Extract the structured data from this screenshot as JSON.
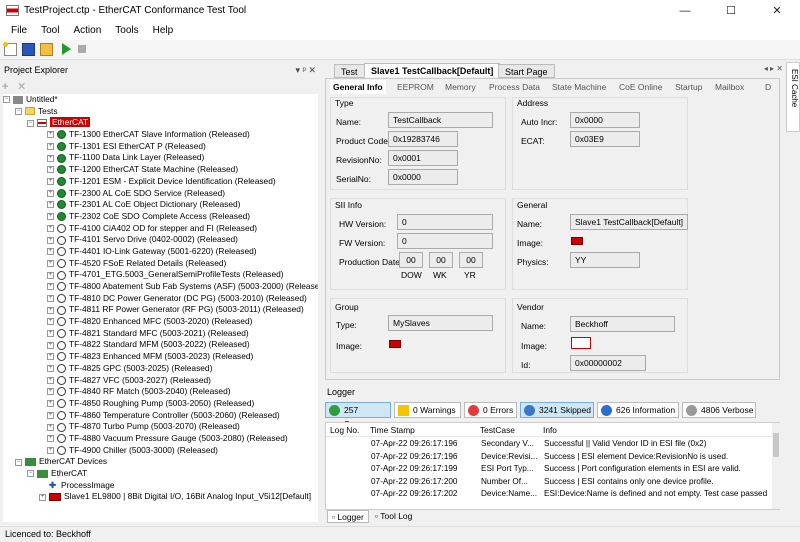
{
  "window": {
    "title": "TestProject.ctp - EtherCAT Conformance Test Tool",
    "minimize": "—",
    "maximize": "☐",
    "close": "✕"
  },
  "menu": [
    "File",
    "Tool",
    "Action",
    "Tools",
    "Help"
  ],
  "explorer": {
    "title": "Project Explorer",
    "pin": "▾ ᵖ ✕",
    "root": "Untitled*",
    "tests": "Tests",
    "ethercat": "EtherCAT",
    "items": [
      {
        "label": "TF-1300 EtherCAT Slave Information (Released)",
        "status": "pass"
      },
      {
        "label": "TF-1301 ESI EtherCAT P (Released)",
        "status": "pass"
      },
      {
        "label": "TF-1100 Data Link Layer (Released)",
        "status": "pass"
      },
      {
        "label": "TF-1200 EtherCAT State Machine (Released)",
        "status": "pass"
      },
      {
        "label": "TF-1201 ESM - Explicit Device Identification (Released)",
        "status": "pass"
      },
      {
        "label": "TF-2300 AL CoE SDO Service (Released)",
        "status": "pass"
      },
      {
        "label": "TF-2301 AL CoE Object Dictionary (Released)",
        "status": "pass"
      },
      {
        "label": "TF-2302 CoE SDO Complete Access (Released)",
        "status": "pass"
      },
      {
        "label": "TF-4100 CiA402 OD for stepper and FI (Released)",
        "status": "none"
      },
      {
        "label": "TF-4101 Servo Drive (0402-0002) (Released)",
        "status": "none"
      },
      {
        "label": "TF-4401 IO-Link Gateway (5001-6220) (Released)",
        "status": "none"
      },
      {
        "label": "TF-4520 FSoE Related Details (Released)",
        "status": "none"
      },
      {
        "label": "TF-4701_ETG.5003_GeneralSemiProfileTests (Released)",
        "status": "none"
      },
      {
        "label": "TF-4800 Abatement Sub Fab Systems (ASF) (5003-2000) (Released)",
        "status": "none"
      },
      {
        "label": "TF-4810 DC Power Generator (DC PG) (5003-2010) (Released)",
        "status": "none"
      },
      {
        "label": "TF-4811 RF Power Generator (RF PG) (5003-2011) (Released)",
        "status": "none"
      },
      {
        "label": "TF-4820 Enhanced MFC (5003-2020) (Released)",
        "status": "none"
      },
      {
        "label": "TF-4821 Standard MFC (5003-2021) (Released)",
        "status": "none"
      },
      {
        "label": "TF-4822 Standard MFM (5003-2022) (Released)",
        "status": "none"
      },
      {
        "label": "TF-4823 Enhanced MFM (5003-2023) (Released)",
        "status": "none"
      },
      {
        "label": "TF-4825 GPC (5003-2025) (Released)",
        "status": "none"
      },
      {
        "label": "TF-4827 VFC (5003-2027) (Released)",
        "status": "none"
      },
      {
        "label": "TF-4840 RF Match (5003-2040) (Released)",
        "status": "none"
      },
      {
        "label": "TF-4850 Roughing Pump (5003-2050) (Released)",
        "status": "none"
      },
      {
        "label": "TF-4860 Temperature Controller (5003-2060) (Released)",
        "status": "none"
      },
      {
        "label": "TF-4870 Turbo Pump (5003-2070) (Released)",
        "status": "none"
      },
      {
        "label": "TF-4880 Vacuum Pressure Gauge (5003-2080) (Released)",
        "status": "none"
      },
      {
        "label": "TF-4900 Chiller (5003-3000) (Released)",
        "status": "none"
      }
    ],
    "devices": "EtherCAT Devices",
    "dev_ethercat": "EtherCAT",
    "process_image": "ProcessImage",
    "slave": "Slave1 EL9800 | 8Bit Digital I/O, 16Bit Analog Input_V5i12[Default]"
  },
  "tabs": [
    "Test",
    "Slave1 TestCallback[Default]",
    "Start Page"
  ],
  "subtabs": [
    "General Info",
    "EEPROM",
    "Memory",
    "Process Data",
    "State Machine",
    "CoE Online",
    "Startup",
    "Mailbox",
    "D"
  ],
  "side_tab": "ESI Cache",
  "type": {
    "title": "Type",
    "name_lbl": "Name:",
    "name": "TestCallback",
    "pc_lbl": "Product Code:",
    "pc": "0x19283746",
    "rev_lbl": "RevisionNo:",
    "rev": "0x0001",
    "sn_lbl": "SerialNo:",
    "sn": "0x0000"
  },
  "address": {
    "title": "Address",
    "ai_lbl": "Auto Incr:",
    "ai": "0x0000",
    "ecat_lbl": "ECAT:",
    "ecat": "0x03E9"
  },
  "sii": {
    "title": "SII Info",
    "hw_lbl": "HW Version:",
    "hw": "0",
    "fw_lbl": "FW Version:",
    "fw": "0",
    "pd_lbl": "Production Date:",
    "dow": "00",
    "wk": "00",
    "yr": "00",
    "dow_lbl": "DOW",
    "wk_lbl": "WK",
    "yr_lbl": "YR"
  },
  "general": {
    "title": "General",
    "name_lbl": "Name:",
    "name": "Slave1 TestCallback[Default]",
    "image_lbl": "Image:",
    "phys_lbl": "Physics:",
    "phys": "YY"
  },
  "group": {
    "title": "Group",
    "type_lbl": "Type:",
    "type": "MySlaves",
    "image_lbl": "Image:"
  },
  "vendor": {
    "title": "Vendor",
    "name_lbl": "Name:",
    "name": "Beckhoff",
    "image_lbl": "Image:",
    "id_lbl": "Id:",
    "id": "0x00000002"
  },
  "logger": {
    "title": "Logger",
    "success": "257 Success",
    "warnings": "0 Warnings",
    "errors": "0 Errors",
    "skipped": "3241 Skipped",
    "information": "626 Information",
    "verbose": "4806 Verbose",
    "cols": [
      "Log No.",
      "Time Stamp",
      "TestCase",
      "Info"
    ],
    "rows": [
      {
        "no": "1",
        "ts": "07-Apr-22 09:26:17:196",
        "tc": "Secondary V...",
        "info": "Successful || Valid Vendor ID in ESI file (0x2)"
      },
      {
        "no": "11",
        "ts": "07-Apr-22 09:26:17:196",
        "tc": "Device:Revisi...",
        "info": "Success | ESI element Device:RevisionNo is used."
      },
      {
        "no": "12",
        "ts": "07-Apr-22 09:26:17:199",
        "tc": "ESI Port Typ...",
        "info": "Success | Port configuration elements in ESI are valid."
      },
      {
        "no": "14",
        "ts": "07-Apr-22 09:26:17:200",
        "tc": "Number Of...",
        "info": "Success | ESI contains only one device profile."
      },
      {
        "no": "15",
        "ts": "07-Apr-22 09:26:17:202",
        "tc": "Device:Name...",
        "info": "ESI:Device:Name is defined and not empty. Test case passed"
      }
    ],
    "bottom_tabs": [
      "Logger",
      "Tool Log"
    ]
  },
  "status": "Licenced to: Beckhoff"
}
